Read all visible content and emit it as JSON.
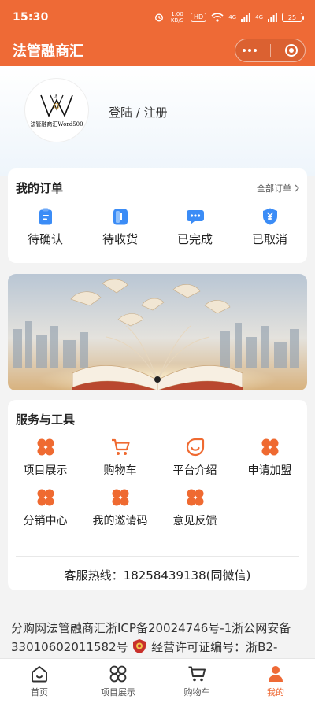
{
  "status_bar": {
    "time": "15:30",
    "speed": "1.00 KB/S",
    "hd": "HD",
    "signal1": "4G",
    "signal2": "4G",
    "battery": "25"
  },
  "nav": {
    "title": "法管融商汇"
  },
  "profile": {
    "avatar_text": "法管融商汇Word500",
    "login_label": "登陆 / 注册"
  },
  "orders": {
    "title": "我的订单",
    "all_label": "全部订单",
    "items": [
      {
        "label": "待确认",
        "icon": "clipboard-icon"
      },
      {
        "label": "待收货",
        "icon": "document-icon"
      },
      {
        "label": "已完成",
        "icon": "chat-bubble-icon"
      },
      {
        "label": "已取消",
        "icon": "yen-shield-icon"
      }
    ]
  },
  "services": {
    "title": "服务与工具",
    "items": [
      {
        "label": "项目展示",
        "icon": "clover-icon"
      },
      {
        "label": "购物车",
        "icon": "cart-icon"
      },
      {
        "label": "平台介绍",
        "icon": "smile-drop-icon"
      },
      {
        "label": "申请加盟",
        "icon": "clover-icon"
      },
      {
        "label": "分销中心",
        "icon": "clover-icon"
      },
      {
        "label": "我的邀请码",
        "icon": "clover-icon"
      },
      {
        "label": "意见反馈",
        "icon": "clover-icon"
      }
    ],
    "hotline": "客服热线：18258439138(同微信)"
  },
  "footer": {
    "line1": "分购网法管融商汇浙ICP备20024746号-1浙公网安备",
    "line2_a": "33010602011582号",
    "line2_b": "经营许可证编号：浙B2-"
  },
  "tabbar": {
    "items": [
      {
        "label": "首页",
        "icon": "home-icon"
      },
      {
        "label": "项目展示",
        "icon": "clover-icon"
      },
      {
        "label": "购物车",
        "icon": "cart-icon"
      },
      {
        "label": "我的",
        "icon": "user-icon"
      }
    ],
    "active_index": 3
  },
  "colors": {
    "brand": "#ee6a36",
    "icon_blue": "#3b8cf6",
    "icon_orange": "#ef6a31"
  }
}
